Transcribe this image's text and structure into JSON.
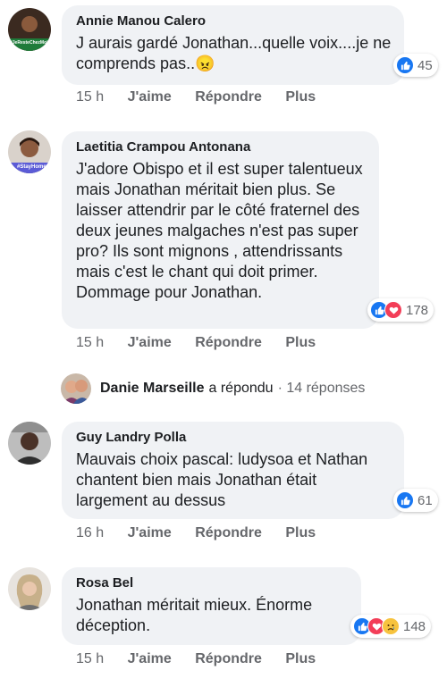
{
  "comments": [
    {
      "author": "Annie Manou Calero",
      "text": "J aurais gardé Jonathan...quelle voix....je ne comprends pas..😠",
      "reactions": [
        "like"
      ],
      "count": "45",
      "time": "15 h",
      "like_label": "J'aime",
      "reply_label": "Répondre",
      "more_label": "Plus",
      "avatar_text": "#JeResteChezMoi"
    },
    {
      "author": "Laetitia Crampou Antonana",
      "text": "J'adore Obispo et il est super talentueux mais Jonathan méritait bien plus. Se laisser attendrir par le côté fraternel des deux jeunes malgaches n'est pas super pro? Ils sont mignons , attendrissants mais c'est le chant qui doit primer. Dommage pour Jonathan.",
      "reactions": [
        "like",
        "love"
      ],
      "count": "178",
      "time": "15 h",
      "like_label": "J'aime",
      "reply_label": "Répondre",
      "more_label": "Plus",
      "avatar_text": "#StayHome"
    },
    {
      "author": "Guy Landry Polla",
      "text": "Mauvais choix pascal: ludysoa et Nathan chantent bien mais Jonathan était largement au dessus",
      "reactions": [
        "like"
      ],
      "count": "61",
      "time": "16 h",
      "like_label": "J'aime",
      "reply_label": "Répondre",
      "more_label": "Plus"
    },
    {
      "author": "Rosa Bel",
      "text": "Jonathan méritait mieux. Énorme déception.",
      "reactions": [
        "like",
        "love",
        "sad"
      ],
      "count": "148",
      "time": "15 h",
      "like_label": "J'aime",
      "reply_label": "Répondre",
      "more_label": "Plus"
    }
  ],
  "reply_thread": {
    "name": "Danie Marseille",
    "verb": "a répondu",
    "count": "· 14 réponses"
  },
  "colors": {
    "bubble": "#f0f2f5",
    "like": "#1877f2",
    "love": "#f33e58",
    "sad": "#f7c33e",
    "secondary_text": "#65676b"
  }
}
